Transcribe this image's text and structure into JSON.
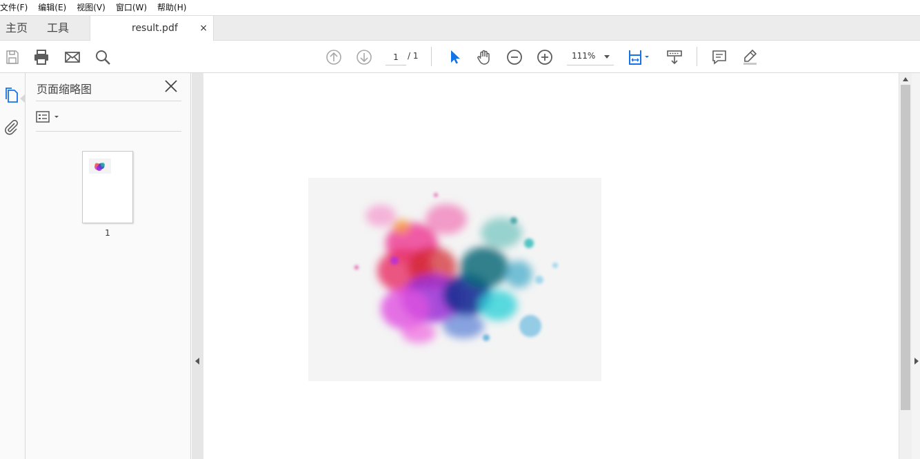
{
  "menu": {
    "items": [
      {
        "label": "文件(F)"
      },
      {
        "label": "编辑(E)"
      },
      {
        "label": "视图(V)"
      },
      {
        "label": "窗口(W)"
      },
      {
        "label": "帮助(H)"
      }
    ]
  },
  "tabs": {
    "home_label": "主页",
    "tools_label": "工具",
    "document_title": "result.pdf",
    "close_glyph": "×"
  },
  "toolbar": {
    "icons": [
      "save-icon",
      "print-icon",
      "email-icon",
      "search-icon",
      "prev-page-icon",
      "next-page-icon",
      "select-arrow-icon",
      "hand-tool-icon",
      "zoom-out-icon",
      "zoom-in-icon",
      "fit-page-icon",
      "scroll-mode-icon",
      "comment-icon",
      "highlight-pen-icon"
    ],
    "page_current": "1",
    "page_total": "/ 1",
    "zoom_value": "111%"
  },
  "sidebar": {
    "icons": [
      "page-thumbnails-icon",
      "attachments-icon"
    ],
    "panel_title": "页面缩略图",
    "thumbnails": [
      {
        "page_label": "1"
      }
    ]
  },
  "colors": {
    "accent": "#1473e6",
    "icon_gray": "#5c5c5c",
    "disabled_gray": "#a0a0a0"
  }
}
